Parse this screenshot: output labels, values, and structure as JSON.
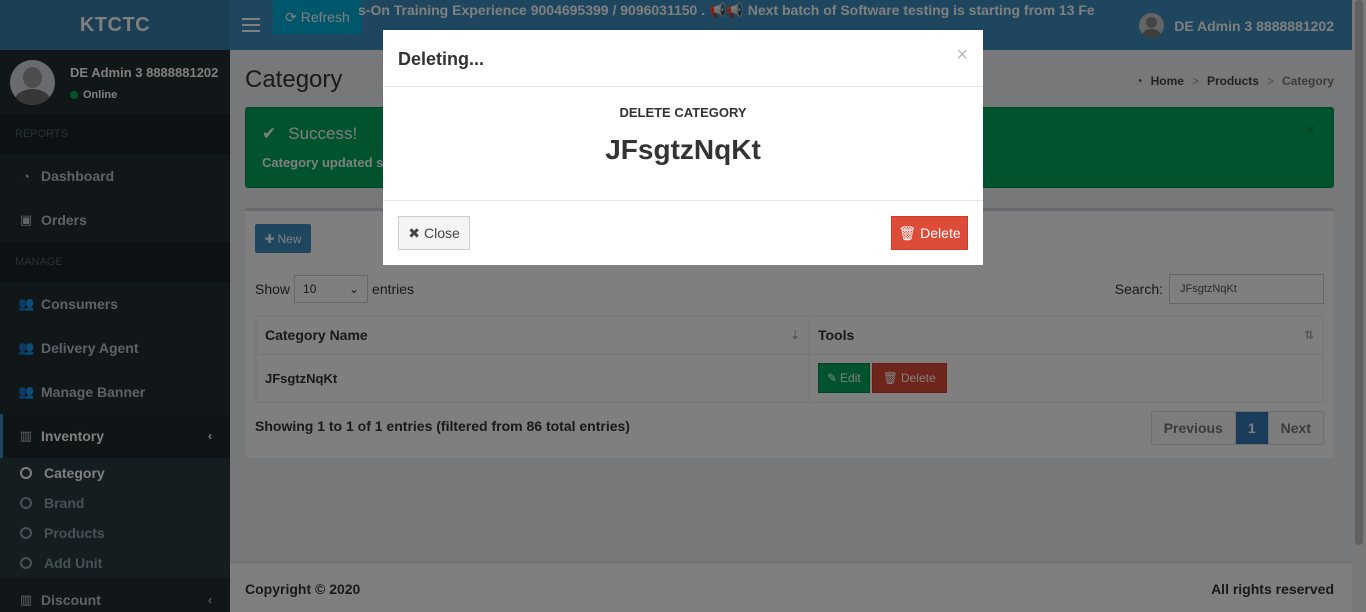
{
  "header": {
    "logo": "KTCTC",
    "refresh_label": "Refresh",
    "marquee": "s-On Training Experience 9004695399 / 9096031150 . 📢📢 Next batch of Software testing is starting from 13 Fe",
    "user_name": "DE Admin 3 8888881202"
  },
  "sidebar": {
    "user_name": "DE Admin 3 8888881202",
    "status": "Online",
    "sections": {
      "reports": "REPORTS",
      "manage": "MANAGE"
    },
    "items": {
      "dashboard": "Dashboard",
      "orders": "Orders",
      "consumers": "Consumers",
      "delivery_agent": "Delivery Agent",
      "manage_banner": "Manage Banner",
      "inventory": "Inventory",
      "discount": "Discount"
    },
    "inventory_sub": {
      "category": "Category",
      "brand": "Brand",
      "products": "Products",
      "add_unit": "Add Unit"
    }
  },
  "content": {
    "title": "Category",
    "breadcrumb": [
      "Home",
      "Products",
      "Category"
    ],
    "alert": {
      "title": "Success!",
      "message": "Category updated su"
    },
    "new_label": "New",
    "show_label": "Show",
    "entries_value": "10",
    "entries_label": "entries",
    "search_label": "Search:",
    "search_value": "JFsgtzNqKt",
    "table": {
      "headers": [
        "Category Name",
        "Tools"
      ],
      "rows": [
        {
          "name": "JFsgtzNqKt",
          "edit": "Edit",
          "delete": "Delete"
        }
      ]
    },
    "info": "Showing 1 to 1 of 1 entries (filtered from 86 total entries)",
    "pagination": {
      "previous": "Previous",
      "page": "1",
      "next": "Next"
    }
  },
  "footer": {
    "copyright": "Copyright © 2020",
    "rights": "All rights reserved"
  },
  "modal": {
    "title": "Deleting...",
    "close_x": "×",
    "label": "DELETE CATEGORY",
    "name": "JFsgtzNqKt",
    "close_label": "Close",
    "delete_label": "Delete"
  }
}
